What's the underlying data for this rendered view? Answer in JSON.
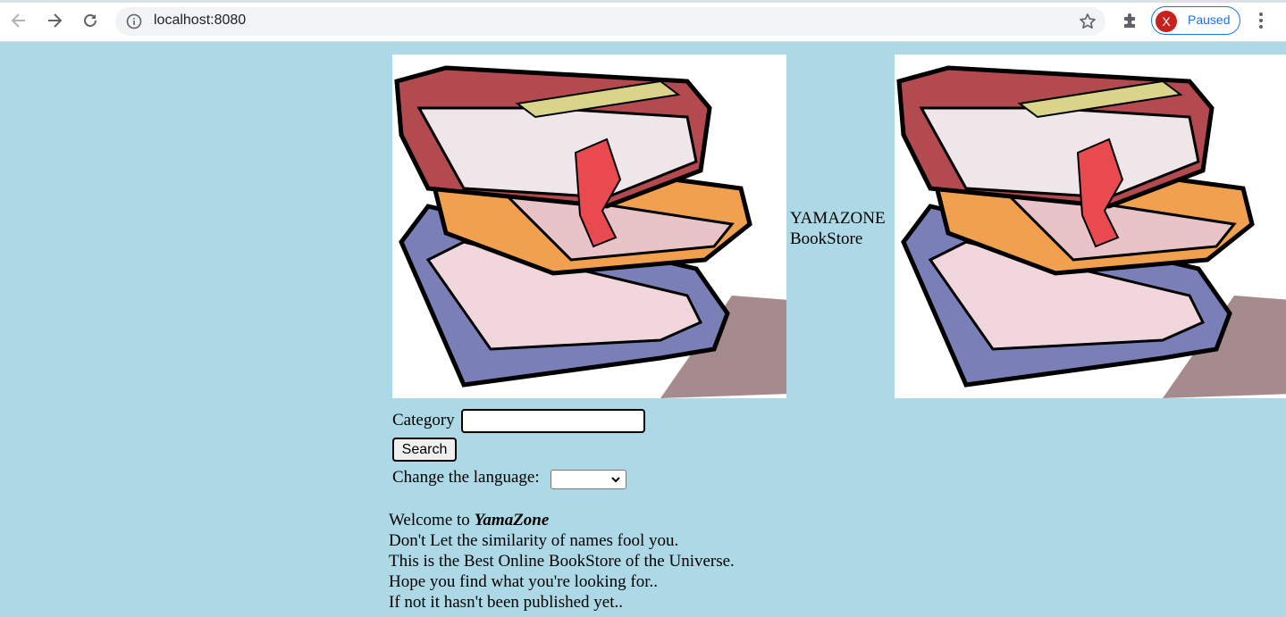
{
  "browser": {
    "url": "localhost:8080",
    "profile_initial": "X",
    "profile_status": "Paused"
  },
  "page": {
    "brand_line1": "YAMAZONE",
    "brand_line2": "BookStore",
    "category_label": "Category",
    "category_value": "",
    "search_label": "Search",
    "language_label": "Change the language:",
    "language_selected": "",
    "welcome_prefix": "Welcome to ",
    "welcome_name": "YamaZone",
    "lines": [
      "Don't Let the similarity of names fool you.",
      "This is the Best Online BookStore of the Universe.",
      "Hope you find what you're looking for..",
      "If not it hasn't been published yet.."
    ]
  },
  "colors": {
    "page_background": "#add8e6",
    "profile_accent": "#1a73e8",
    "avatar": "#c5221f"
  },
  "icons": [
    "back-arrow-icon",
    "forward-arrow-icon",
    "reload-icon",
    "info-icon",
    "star-icon",
    "extensions-puzzle-icon",
    "kebab-menu-icon",
    "chevron-down-icon",
    "book-stack-image"
  ]
}
